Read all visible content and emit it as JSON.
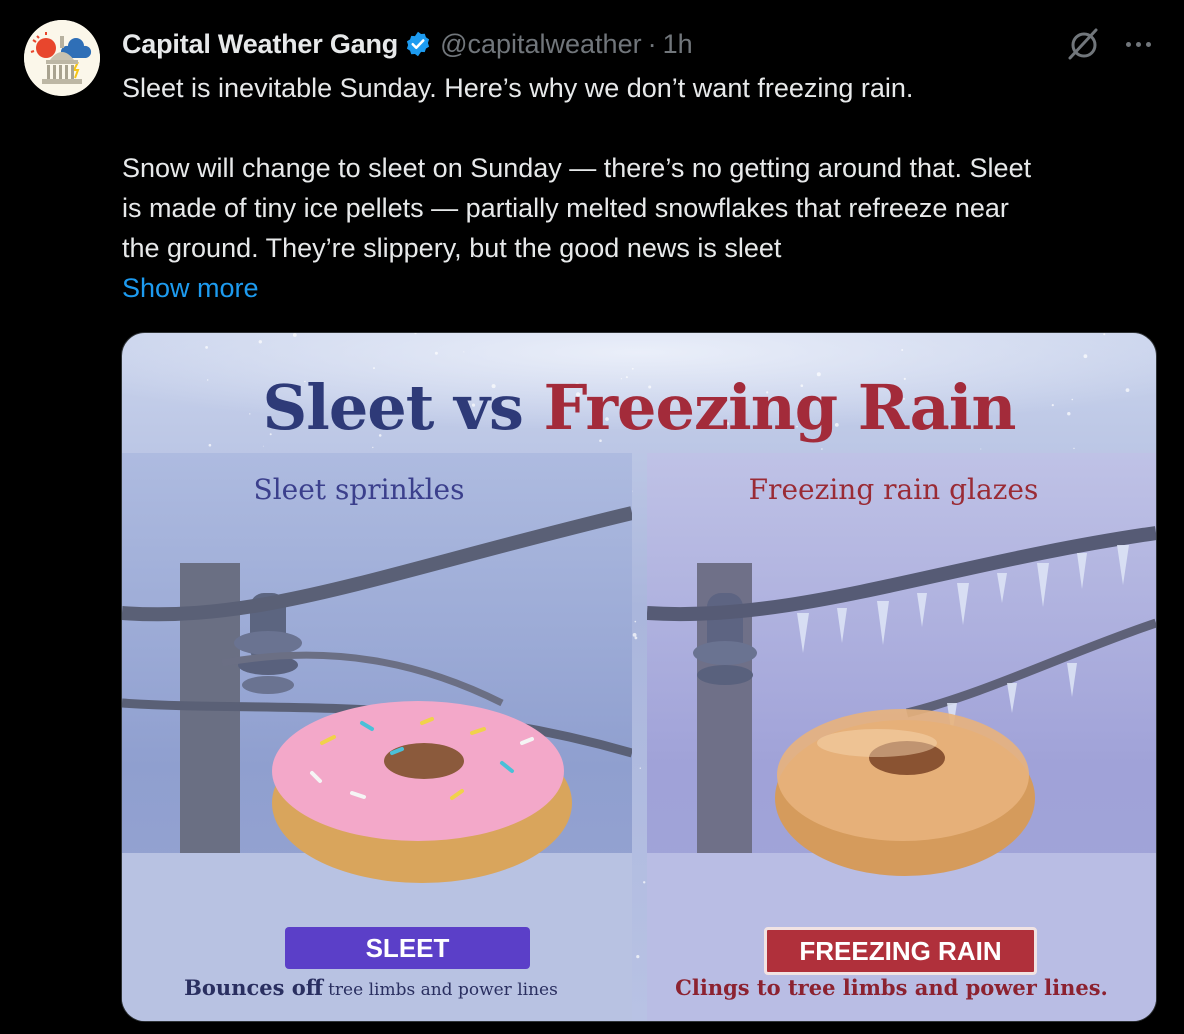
{
  "tweet": {
    "author": {
      "display_name": "Capital Weather Gang",
      "handle": "@capitalweather",
      "separator": "·",
      "timestamp": "1h",
      "verified": true
    },
    "text_lines": [
      "Sleet is inevitable Sunday. Here’s why we don’t want freezing rain.",
      "Snow will change to sleet on Sunday — there’s no getting around that. Sleet",
      "is made of tiny ice pellets — partially melted snowflakes that refreeze near",
      "the ground. They’re slippery, but the good news is sleet"
    ],
    "show_more_label": "Show more",
    "icons": {
      "grok": "grok-icon",
      "more": "more-icon",
      "verified": "verified-badge-icon"
    },
    "accent_color": "#1d9bf0"
  },
  "media": {
    "title_part1": "Sleet vs",
    "title_part2": "Freezing Rain",
    "left_panel": {
      "heading": "Sleet sprinkles",
      "badge": "SLEET",
      "caption_big": "Bounces off",
      "caption_small": "tree limbs and power lines"
    },
    "right_panel": {
      "heading": "Freezing rain glazes",
      "badge": "FREEZING RAIN",
      "caption_big": "Clings to tree limbs and power lines."
    }
  }
}
